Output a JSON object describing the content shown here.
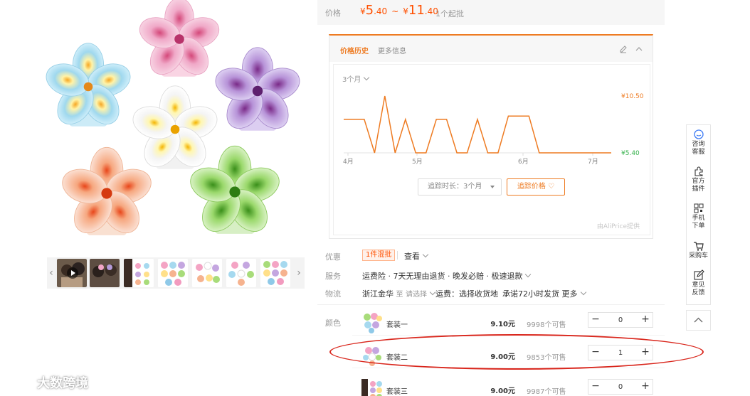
{
  "price": {
    "label": "价格",
    "currency": "¥",
    "min_int": "5",
    "min_dec": ".40",
    "tilde": "~",
    "max_int": "11",
    "max_dec": ".40",
    "moq": "1个起批"
  },
  "price_history": {
    "tab_active": "价格历史",
    "tab_other": "更多信息",
    "range_selector": "3个月",
    "duration_button": "追踪时长：3个月",
    "track_button": "追踪价格 ♡",
    "source_note": "由AliPrice提供",
    "accent_color": "#ee7b22",
    "low_color": "#37b24d"
  },
  "chart_data": {
    "type": "line",
    "x_ticks": [
      "4月",
      "5月",
      "6月",
      "7月"
    ],
    "y_max_label": "¥10.50",
    "y_min_label": "¥5.40",
    "ylim": [
      5.4,
      10.5
    ],
    "x": [
      0,
      1,
      2,
      3,
      4,
      5,
      6,
      7,
      8,
      9,
      10,
      11,
      12,
      13,
      14,
      15,
      16,
      17,
      18,
      19,
      20,
      21,
      22,
      23,
      24,
      25,
      26
    ],
    "values": [
      8.4,
      8.4,
      8.4,
      5.4,
      10.5,
      5.4,
      8.4,
      5.4,
      5.4,
      8.4,
      8.4,
      5.4,
      5.4,
      8.4,
      5.4,
      5.4,
      8.7,
      8.7,
      8.7,
      5.4,
      5.4,
      5.4,
      5.4,
      5.4,
      5.4,
      5.4,
      5.4
    ],
    "series_color": "#ee7b22"
  },
  "promotion": {
    "label": "优惠",
    "tag": "1件混批",
    "view": "查看"
  },
  "service": {
    "label": "服务",
    "text": "运费险 · 7天无理由退货 · 晚发必赔 · 极速退款"
  },
  "logistics": {
    "label": "物流",
    "origin": "浙江金华",
    "to": "至",
    "select": "请选择",
    "fee": "运费：选择收货地",
    "promise": "承诺72小时发货",
    "more": "更多"
  },
  "sku": {
    "label": "颜色",
    "items": [
      {
        "name": "套装一",
        "price": "9.10元",
        "stock": "9998个可售",
        "qty": "0"
      },
      {
        "name": "套装二",
        "price": "9.00元",
        "stock": "9853个可售",
        "qty": "1"
      },
      {
        "name": "套装三",
        "price": "9.00元",
        "stock": "9987个可售",
        "qty": "0"
      }
    ]
  },
  "toolbar": {
    "items": [
      {
        "label_top": "咨询",
        "label_bottom": "客服",
        "icon": "chat-icon"
      },
      {
        "label_top": "官方",
        "label_bottom": "插件",
        "icon": "puzzle-icon"
      },
      {
        "label_top": "手机",
        "label_bottom": "下单",
        "icon": "qrcode-icon"
      },
      {
        "label_top": "采购车",
        "label_bottom": "",
        "icon": "cart-icon"
      },
      {
        "label_top": "意见",
        "label_bottom": "反馈",
        "icon": "edit-icon"
      }
    ]
  },
  "watermark": {
    "text": "大数跨境"
  }
}
